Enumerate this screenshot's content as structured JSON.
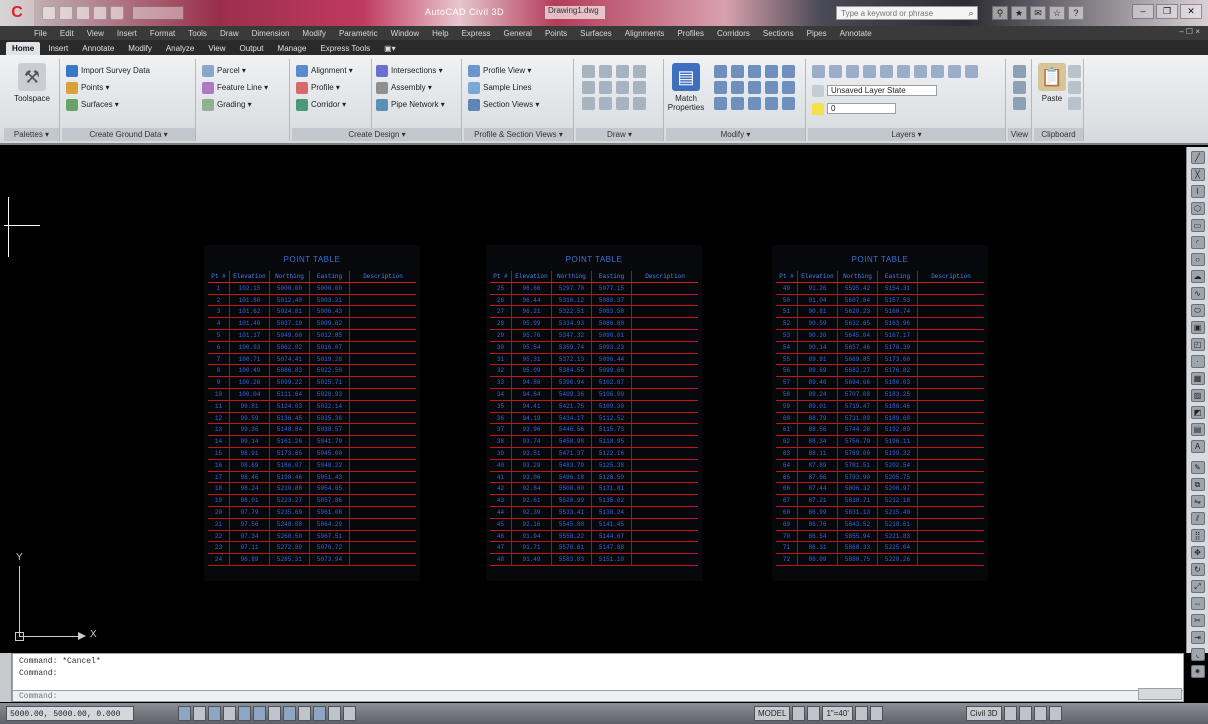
{
  "title_bar": {
    "window_title": "AutoCAD Civil 3D",
    "file_name": "Drawing1.dwg",
    "search_placeholder": "Type a keyword or phrase",
    "minimize": "–",
    "restore": "❐",
    "close": "✕"
  },
  "menubar": {
    "items": [
      "File",
      "Edit",
      "View",
      "Insert",
      "Format",
      "Tools",
      "Draw",
      "Dimension",
      "Modify",
      "Parametric",
      "Window",
      "Help",
      "Express",
      "General",
      "Points",
      "Surfaces",
      "Alignments",
      "Profiles",
      "Corridors",
      "Sections",
      "Pipes",
      "Annotate"
    ],
    "right": "– ☐ ×"
  },
  "ribbon_tabs": [
    "Home",
    "Insert",
    "Annotate",
    "Modify",
    "Analyze",
    "View",
    "Output",
    "Manage",
    "Express Tools",
    "▣▾"
  ],
  "ribbon": {
    "panels": [
      {
        "title": "Palettes ▾",
        "big": "Toolspace"
      },
      {
        "title": "Create Ground Data ▾",
        "rows": [
          "Import Survey Data",
          "Points ▾",
          "Surfaces ▾"
        ],
        "rows2": [
          "Parcel ▾",
          "Feature Line ▾",
          "Grading ▾"
        ]
      },
      {
        "title": "Create Design ▾",
        "rows": [
          "Alignment ▾",
          "Profile ▾",
          "Corridor ▾"
        ],
        "rows2": [
          "Intersections ▾",
          "Assembly ▾",
          "Pipe Network ▾"
        ]
      },
      {
        "title": "Profile & Section Views ▾",
        "rows": [
          "Profile View ▾",
          "Sample Lines",
          "Section Views ▾"
        ]
      },
      {
        "title": "Draw ▾"
      },
      {
        "title": "Modify ▾",
        "big": "Match Properties"
      },
      {
        "title": "Layers ▾",
        "rows": [
          "Unsaved Layer State",
          "0"
        ]
      },
      {
        "title": "View"
      },
      {
        "title": "Clipboard",
        "big": "Paste"
      }
    ]
  },
  "drawing": {
    "tables": [
      {
        "title": "POINT TABLE",
        "headers": [
          "Pt #",
          "Elevation",
          "Northing",
          "Easting",
          "Description"
        ],
        "rows": [
          [
            "1",
            "102.15",
            "5000.00",
            "5000.00",
            ""
          ],
          [
            "2",
            "101.88",
            "5012.40",
            "5003.21",
            ""
          ],
          [
            "3",
            "101.62",
            "5024.81",
            "5006.43",
            ""
          ],
          [
            "4",
            "101.40",
            "5037.19",
            "5009.62",
            ""
          ],
          [
            "5",
            "101.17",
            "5049.60",
            "5012.85",
            ""
          ],
          [
            "6",
            "100.93",
            "5062.02",
            "5016.07",
            ""
          ],
          [
            "7",
            "100.71",
            "5074.41",
            "5019.28",
            ""
          ],
          [
            "8",
            "100.49",
            "5086.83",
            "5022.50",
            ""
          ],
          [
            "9",
            "100.26",
            "5099.22",
            "5025.71",
            ""
          ],
          [
            "10",
            "100.04",
            "5111.64",
            "5028.93",
            ""
          ],
          [
            "11",
            "99.81",
            "5124.03",
            "5032.14",
            ""
          ],
          [
            "12",
            "99.59",
            "5136.45",
            "5035.36",
            ""
          ],
          [
            "13",
            "99.36",
            "5148.84",
            "5038.57",
            ""
          ],
          [
            "14",
            "99.14",
            "5161.26",
            "5041.79",
            ""
          ],
          [
            "15",
            "98.91",
            "5173.65",
            "5045.00",
            ""
          ],
          [
            "16",
            "98.69",
            "5186.07",
            "5048.22",
            ""
          ],
          [
            "17",
            "98.46",
            "5198.46",
            "5051.43",
            ""
          ],
          [
            "18",
            "98.24",
            "5210.88",
            "5054.65",
            ""
          ],
          [
            "19",
            "98.01",
            "5223.27",
            "5057.86",
            ""
          ],
          [
            "20",
            "97.79",
            "5235.69",
            "5061.08",
            ""
          ],
          [
            "21",
            "97.56",
            "5248.08",
            "5064.29",
            ""
          ],
          [
            "22",
            "97.34",
            "5260.50",
            "5067.51",
            ""
          ],
          [
            "23",
            "97.11",
            "5272.89",
            "5070.72",
            ""
          ],
          [
            "24",
            "96.89",
            "5285.31",
            "5073.94",
            ""
          ]
        ]
      },
      {
        "title": "POINT TABLE",
        "headers": [
          "Pt #",
          "Elevation",
          "Northing",
          "Easting",
          "Description"
        ],
        "rows": [
          [
            "25",
            "96.66",
            "5297.70",
            "5077.15",
            ""
          ],
          [
            "26",
            "96.44",
            "5310.12",
            "5080.37",
            ""
          ],
          [
            "27",
            "96.21",
            "5322.51",
            "5083.58",
            ""
          ],
          [
            "28",
            "95.99",
            "5334.93",
            "5086.80",
            ""
          ],
          [
            "29",
            "95.76",
            "5347.32",
            "5090.01",
            ""
          ],
          [
            "30",
            "95.54",
            "5359.74",
            "5093.23",
            ""
          ],
          [
            "31",
            "95.31",
            "5372.13",
            "5096.44",
            ""
          ],
          [
            "32",
            "95.09",
            "5384.55",
            "5099.66",
            ""
          ],
          [
            "33",
            "94.86",
            "5396.94",
            "5102.87",
            ""
          ],
          [
            "34",
            "94.64",
            "5409.36",
            "5106.09",
            ""
          ],
          [
            "35",
            "94.41",
            "5421.75",
            "5109.30",
            ""
          ],
          [
            "36",
            "94.19",
            "5434.17",
            "5112.52",
            ""
          ],
          [
            "37",
            "93.96",
            "5446.56",
            "5115.73",
            ""
          ],
          [
            "38",
            "93.74",
            "5458.98",
            "5118.95",
            ""
          ],
          [
            "39",
            "93.51",
            "5471.37",
            "5122.16",
            ""
          ],
          [
            "40",
            "93.29",
            "5483.79",
            "5125.38",
            ""
          ],
          [
            "41",
            "93.06",
            "5496.18",
            "5128.59",
            ""
          ],
          [
            "42",
            "92.84",
            "5508.60",
            "5131.81",
            ""
          ],
          [
            "43",
            "92.61",
            "5520.99",
            "5135.02",
            ""
          ],
          [
            "44",
            "92.39",
            "5533.41",
            "5138.24",
            ""
          ],
          [
            "45",
            "92.16",
            "5545.80",
            "5141.45",
            ""
          ],
          [
            "46",
            "91.94",
            "5558.22",
            "5144.67",
            ""
          ],
          [
            "47",
            "91.71",
            "5570.61",
            "5147.88",
            ""
          ],
          [
            "48",
            "91.49",
            "5583.03",
            "5151.10",
            ""
          ]
        ]
      },
      {
        "title": "POINT TABLE",
        "headers": [
          "Pt #",
          "Elevation",
          "Northing",
          "Easting",
          "Description"
        ],
        "rows": [
          [
            "49",
            "91.26",
            "5595.42",
            "5154.31",
            ""
          ],
          [
            "50",
            "91.04",
            "5607.84",
            "5157.53",
            ""
          ],
          [
            "51",
            "90.81",
            "5620.23",
            "5160.74",
            ""
          ],
          [
            "52",
            "90.59",
            "5632.65",
            "5163.96",
            ""
          ],
          [
            "53",
            "90.36",
            "5645.04",
            "5167.17",
            ""
          ],
          [
            "54",
            "90.14",
            "5657.46",
            "5170.39",
            ""
          ],
          [
            "55",
            "89.91",
            "5669.85",
            "5173.60",
            ""
          ],
          [
            "56",
            "89.69",
            "5682.27",
            "5176.82",
            ""
          ],
          [
            "57",
            "89.46",
            "5694.66",
            "5180.03",
            ""
          ],
          [
            "58",
            "89.24",
            "5707.08",
            "5183.25",
            ""
          ],
          [
            "59",
            "89.01",
            "5719.47",
            "5186.46",
            ""
          ],
          [
            "60",
            "88.79",
            "5731.89",
            "5189.68",
            ""
          ],
          [
            "61",
            "88.56",
            "5744.28",
            "5192.89",
            ""
          ],
          [
            "62",
            "88.34",
            "5756.70",
            "5196.11",
            ""
          ],
          [
            "63",
            "88.11",
            "5769.09",
            "5199.32",
            ""
          ],
          [
            "64",
            "87.89",
            "5781.51",
            "5202.54",
            ""
          ],
          [
            "65",
            "87.66",
            "5793.90",
            "5205.75",
            ""
          ],
          [
            "66",
            "87.44",
            "5806.32",
            "5208.97",
            ""
          ],
          [
            "67",
            "87.21",
            "5818.71",
            "5212.18",
            ""
          ],
          [
            "68",
            "86.99",
            "5831.13",
            "5215.40",
            ""
          ],
          [
            "69",
            "86.76",
            "5843.52",
            "5218.61",
            ""
          ],
          [
            "70",
            "86.54",
            "5855.94",
            "5221.83",
            ""
          ],
          [
            "71",
            "86.31",
            "5868.33",
            "5225.04",
            ""
          ],
          [
            "72",
            "86.09",
            "5880.75",
            "5228.26",
            ""
          ]
        ]
      }
    ],
    "ucs_y": "Y",
    "ucs_x": "X"
  },
  "command": {
    "history": [
      "Command: *Cancel*",
      "Command:"
    ],
    "prompt": "Command:"
  },
  "statusbar": {
    "coords": "5000.00, 5000.00, 0.000",
    "model": "MODEL",
    "scale": "1\"=40'",
    "workspace": "Civil 3D"
  },
  "colors": {
    "table_text": "#2f6ae0",
    "table_lines": "#c3141a",
    "canvas": "#000000"
  }
}
